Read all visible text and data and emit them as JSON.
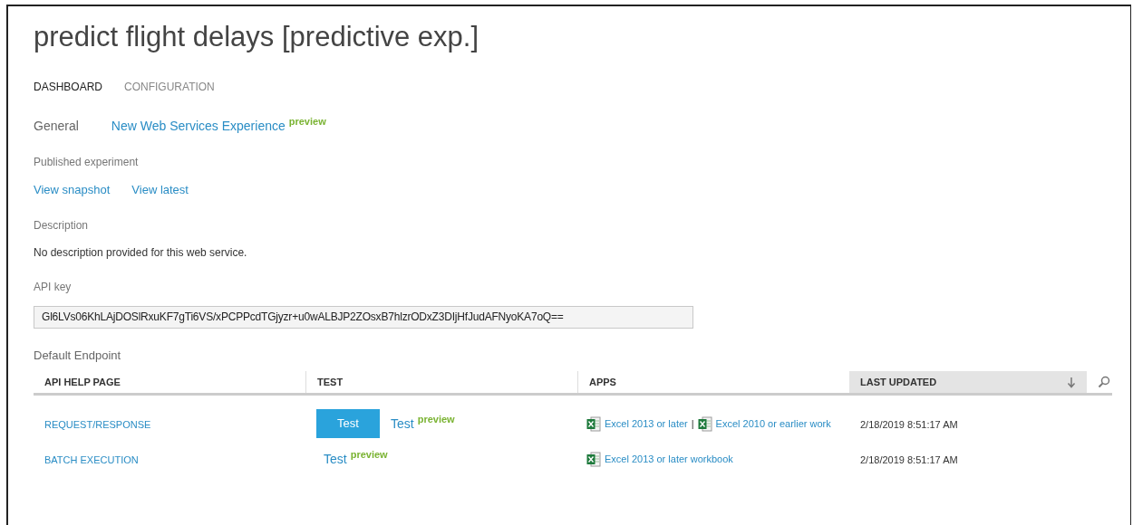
{
  "title": "predict flight delays [predictive exp.]",
  "tabs": [
    {
      "label": "DASHBOARD",
      "selected": true
    },
    {
      "label": "CONFIGURATION",
      "selected": false
    }
  ],
  "general": {
    "label": "General",
    "link": "New Web Services Experience",
    "badge": "preview"
  },
  "published": {
    "label": "Published experiment",
    "links": [
      "View snapshot",
      "View latest"
    ]
  },
  "description": {
    "label": "Description",
    "text": "No description provided for this web service."
  },
  "api_key": {
    "label": "API key",
    "value": "Gl6LVs06KhLAjDOSlRxuKF7gTi6VS/xPCPPcdTGjyzr+u0wALBJP2ZOsxB7hlzrODxZ3DIjHfJudAFNyoKA7oQ=="
  },
  "endpoint": {
    "label": "Default Endpoint",
    "columns": [
      {
        "label": "API HELP PAGE",
        "sorted": false
      },
      {
        "label": "TEST",
        "sorted": false
      },
      {
        "label": "APPS",
        "sorted": false
      },
      {
        "label": "LAST UPDATED",
        "sorted": true
      }
    ],
    "rows": [
      {
        "api_help_page": "REQUEST/RESPONSE",
        "test": {
          "button": "Test",
          "link": "Test",
          "badge": "preview"
        },
        "apps": [
          "Excel 2013 or later",
          "Excel 2010 or earlier work"
        ],
        "separator": "|",
        "last_updated": "2/18/2019 8:51:17 AM"
      },
      {
        "api_help_page": "BATCH EXECUTION",
        "test": {
          "link": "Test",
          "badge": "preview"
        },
        "apps": [
          "Excel 2013 or later workbook"
        ],
        "last_updated": "2/18/2019 8:51:17 AM"
      }
    ]
  }
}
